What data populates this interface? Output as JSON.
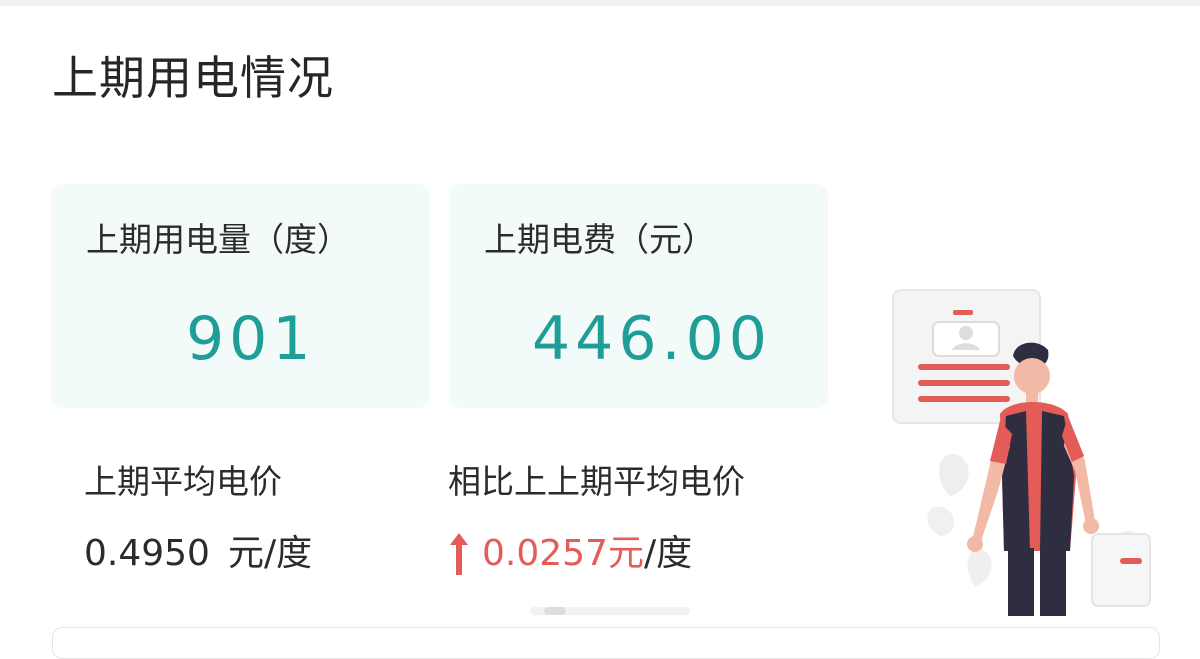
{
  "section": {
    "title": "上期用电情况"
  },
  "cards": {
    "usage": {
      "label": "上期用电量（度）",
      "value": "901"
    },
    "fee": {
      "label": "上期电费（元）",
      "value": "446.00"
    }
  },
  "average_price": {
    "label": "上期平均电价",
    "value": "0.4950",
    "unit": "元/度"
  },
  "comparison": {
    "label": "相比上上期平均电价",
    "direction": "up",
    "value": "0.0257",
    "unit_currency": "元",
    "unit_rest": "/度"
  },
  "colors": {
    "accent_teal": "#1f9e98",
    "card_bg": "#f3fbfa",
    "increase_red": "#e45c58"
  },
  "icons": {
    "arrow": "arrow-up-icon",
    "illustration": "person-with-document-illustration"
  }
}
